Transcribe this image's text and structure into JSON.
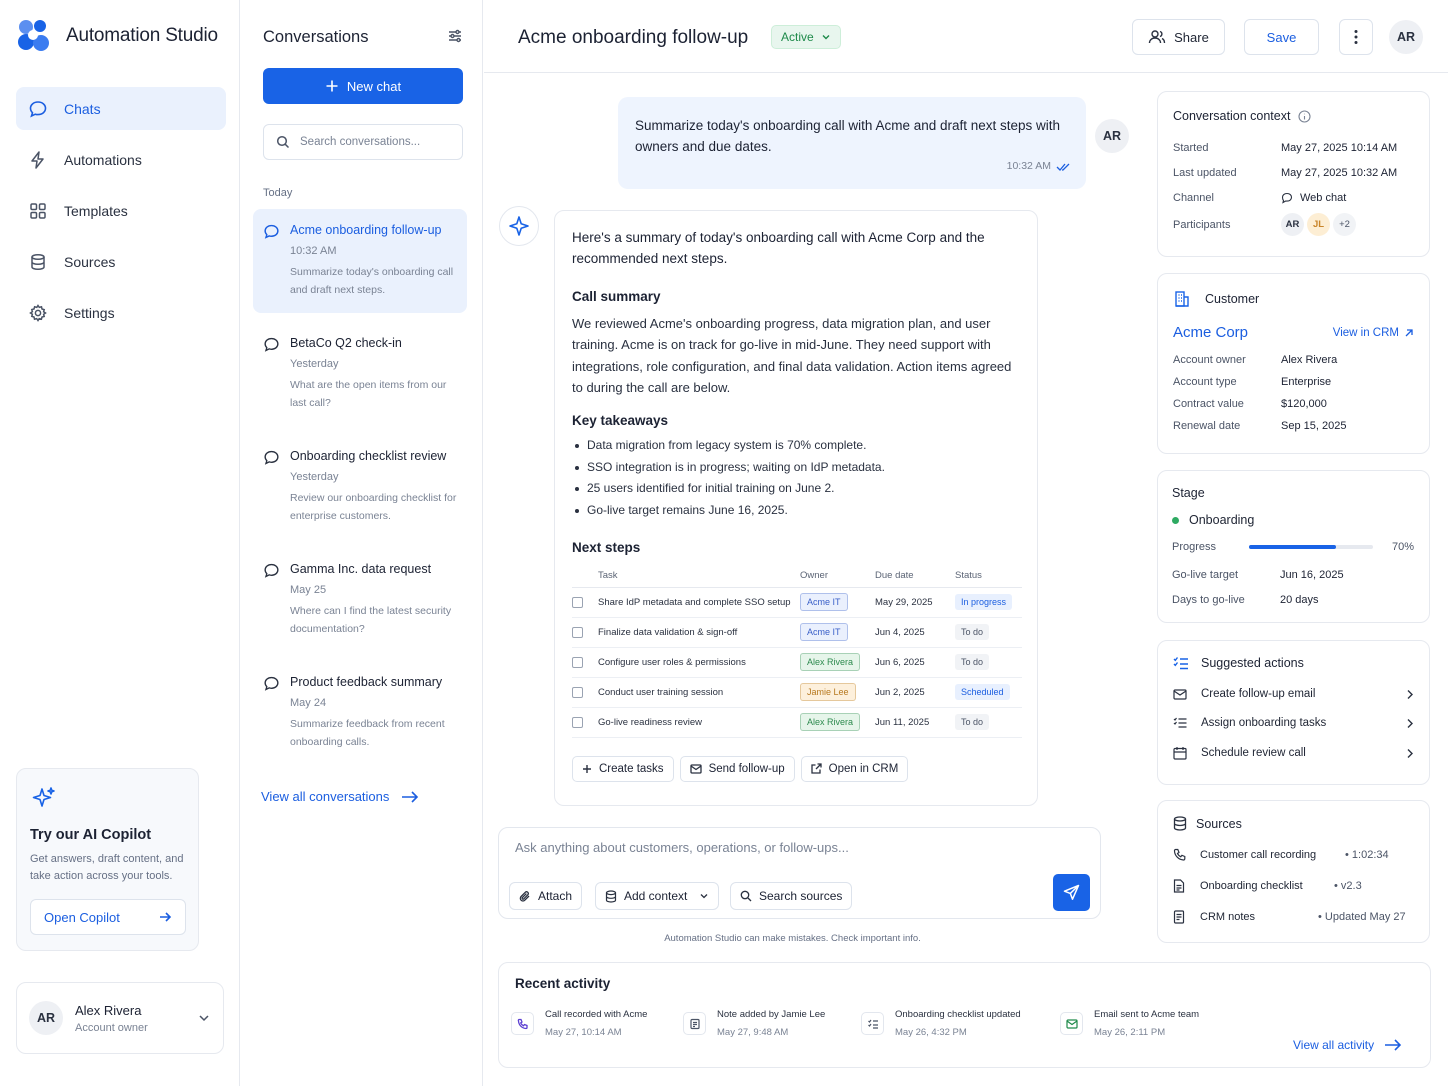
{
  "app": {
    "name": "Automation Studio"
  },
  "nav": [
    {
      "label": "Chats",
      "icon": "chat-icon"
    },
    {
      "label": "Automations",
      "icon": "bolt-icon"
    },
    {
      "label": "Templates",
      "icon": "grid-icon"
    },
    {
      "label": "Sources",
      "icon": "database-icon"
    },
    {
      "label": "Settings",
      "icon": "gear-icon"
    }
  ],
  "copilot": {
    "title": "Try our AI Copilot",
    "desc": "Get answers, draft content, and take action across your tools.",
    "button": "Open Copilot"
  },
  "user": {
    "initials": "AR",
    "name": "Alex Rivera",
    "role": "Account owner"
  },
  "conversations": {
    "title": "Conversations",
    "new_chat": "New chat",
    "search_placeholder": "Search conversations...",
    "group": "Today",
    "items": [
      {
        "title": "Acme onboarding follow-up",
        "date": "10:32 AM",
        "preview": "Summarize today's onboarding call and draft next steps."
      },
      {
        "title": "BetaCo Q2 check-in",
        "date": "Yesterday",
        "preview": "What are the open items from our last call?"
      },
      {
        "title": "Onboarding checklist review",
        "date": "Yesterday",
        "preview": "Review our onboarding checklist for enterprise customers."
      },
      {
        "title": "Gamma Inc. data request",
        "date": "May 25",
        "preview": "Where can I find the latest security documentation?"
      },
      {
        "title": "Product feedback summary",
        "date": "May 24",
        "preview": "Summarize feedback from recent onboarding calls."
      }
    ],
    "view_all": "View all conversations"
  },
  "header": {
    "title": "Acme onboarding follow-up",
    "status": "Active",
    "share": "Share",
    "save": "Save",
    "initials": "AR"
  },
  "chat": {
    "user_message": "Summarize today's onboarding call with Acme and draft next steps with owners and due dates.",
    "user_time": "10:32 AM",
    "user_initials": "AR",
    "intro": "Here's a summary of today's onboarding call with Acme Corp and the recommended next steps.",
    "summary_heading": "Call summary",
    "summary": "We reviewed Acme's onboarding progress, data migration plan, and user training. Acme is on track for go-live in mid-June. They need support with integrations, role configuration, and final data validation. Action items agreed to during the call are below.",
    "takeaways_heading": "Key takeaways",
    "takeaways": [
      "Data migration from legacy system is 70% complete.",
      "SSO integration is in progress; waiting on IdP metadata.",
      "25 users identified for initial training on June 2.",
      "Go-live target remains June 16, 2025."
    ],
    "next_heading": "Next steps",
    "columns": [
      "Task",
      "Owner",
      "Due date",
      "Status"
    ],
    "rows": [
      {
        "task": "Share IdP metadata and complete SSO setup",
        "owner": "Acme IT",
        "owner_color": "#eaf0fd",
        "owner_text": "#3a5fc8",
        "due": "May 29, 2025",
        "status": "In progress",
        "status_color": "#e8f0fe",
        "status_text": "#1b5ee0"
      },
      {
        "task": "Finalize data validation & sign-off",
        "owner": "Acme IT",
        "owner_color": "#eaf0fd",
        "owner_text": "#3a5fc8",
        "due": "Jun 4, 2025",
        "status": "To do",
        "status_color": "#f1f3f6",
        "status_text": "#4b5466"
      },
      {
        "task": "Configure user roles & permissions",
        "owner": "Alex Rivera",
        "owner_color": "#e6f5ea",
        "owner_text": "#2d8a4e",
        "due": "Jun 6, 2025",
        "status": "To do",
        "status_color": "#f1f3f6",
        "status_text": "#4b5466"
      },
      {
        "task": "Conduct user training session",
        "owner": "Jamie Lee",
        "owner_color": "#fdf0dc",
        "owner_text": "#b7791f",
        "due": "Jun 2, 2025",
        "status": "Scheduled",
        "status_color": "#e8f0fe",
        "status_text": "#1b5ee0"
      },
      {
        "task": "Go-live readiness review",
        "owner": "Alex Rivera",
        "owner_color": "#e6f5ea",
        "owner_text": "#2d8a4e",
        "due": "Jun 11, 2025",
        "status": "To do",
        "status_color": "#f1f3f6",
        "status_text": "#4b5466"
      }
    ],
    "actions": [
      "Create tasks",
      "Send follow-up",
      "Open in CRM"
    ]
  },
  "composer": {
    "placeholder": "Ask anything about customers, operations, or follow-ups...",
    "attach": "Attach",
    "context": "Add context",
    "sources": "Search sources",
    "disclaimer": "Automation Studio can make mistakes. Check important info."
  },
  "recent": {
    "title": "Recent activity",
    "items": [
      {
        "text": "Call recorded with Acme",
        "time": "May 27, 10:14 AM",
        "icon": "phone-icon"
      },
      {
        "text": "Note added by Jamie Lee",
        "time": "May 27, 9:48 AM",
        "icon": "note-icon"
      },
      {
        "text": "Onboarding checklist updated",
        "time": "May 26, 4:32 PM",
        "icon": "checklist-icon"
      },
      {
        "text": "Email sent to Acme team",
        "time": "May 26, 2:11 PM",
        "icon": "mail-icon"
      }
    ],
    "view_all": "View all activity"
  },
  "context": {
    "title": "Conversation context",
    "started_label": "Started",
    "started": "May 27, 2025 10:14 AM",
    "updated_label": "Last updated",
    "updated": "May 27, 2025 10:32 AM",
    "channel_label": "Channel",
    "channel": "Web chat",
    "participants_label": "Participants",
    "participants": [
      "AR",
      "JL",
      "+2"
    ]
  },
  "customer": {
    "title": "Customer",
    "name": "Acme Corp",
    "view_crm": "View in CRM",
    "fields": [
      {
        "k": "Account owner",
        "v": "Alex Rivera"
      },
      {
        "k": "Account type",
        "v": "Enterprise"
      },
      {
        "k": "Contract value",
        "v": "$120,000"
      },
      {
        "k": "Renewal date",
        "v": "Sep 15, 2025"
      }
    ]
  },
  "stage": {
    "title": "Stage",
    "name": "Onboarding",
    "progress_label": "Progress",
    "progress": 70,
    "progress_text": "70%",
    "golive_label": "Go-live target",
    "golive": "Jun 16, 2025",
    "days_label": "Days to go-live",
    "days": "20 days"
  },
  "suggested": {
    "title": "Suggested actions",
    "items": [
      "Create follow-up email",
      "Assign onboarding tasks",
      "Schedule review call"
    ]
  },
  "sources": {
    "title": "Sources",
    "items": [
      {
        "name": "Customer call recording",
        "meta": "• 1:02:34"
      },
      {
        "name": "Onboarding checklist",
        "meta": "• v2.3"
      },
      {
        "name": "CRM notes",
        "meta": "• Updated May 27"
      }
    ]
  },
  "colors": {
    "accent": "#1963e6",
    "active_badge": "#1e8a4a"
  }
}
